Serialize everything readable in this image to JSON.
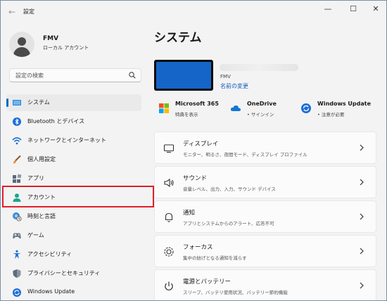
{
  "window": {
    "title": "設定",
    "back_glyph": "←",
    "minimize_glyph": "—",
    "maximize_glyph": "☐",
    "close_glyph": "✕"
  },
  "user": {
    "name": "FMV",
    "account_type": "ローカル アカウント"
  },
  "search": {
    "placeholder": "設定の検索"
  },
  "sidebar": {
    "items": [
      {
        "label": "システム",
        "icon": "display-icon",
        "selected": true
      },
      {
        "label": "Bluetooth とデバイス",
        "icon": "bluetooth-icon"
      },
      {
        "label": "ネットワークとインターネット",
        "icon": "wifi-icon"
      },
      {
        "label": "個人用設定",
        "icon": "brush-icon"
      },
      {
        "label": "アプリ",
        "icon": "apps-icon"
      },
      {
        "label": "アカウント",
        "icon": "account-icon",
        "highlighted": true
      },
      {
        "label": "時刻と言語",
        "icon": "globe-clock-icon"
      },
      {
        "label": "ゲーム",
        "icon": "gamepad-icon"
      },
      {
        "label": "アクセシビリティ",
        "icon": "accessibility-icon"
      },
      {
        "label": "プライバシーとセキュリティ",
        "icon": "shield-icon"
      },
      {
        "label": "Windows Update",
        "icon": "update-icon"
      }
    ]
  },
  "main": {
    "title": "システム",
    "device": {
      "model": "FMV",
      "rename_link": "名前の変更"
    },
    "services": [
      {
        "title": "Microsoft 365",
        "subtitle": "特典を表示",
        "icon": "microsoft-logo-icon"
      },
      {
        "title": "OneDrive",
        "subtitle": "• サインイン",
        "icon": "onedrive-cloud-icon"
      },
      {
        "title": "Windows Update",
        "subtitle": "• 注意が必要",
        "icon": "update-icon"
      }
    ],
    "cards": [
      {
        "title": "ディスプレイ",
        "subtitle": "モニター、明るさ、夜間モード、ディスプレイ プロファイル",
        "icon": "monitor-icon"
      },
      {
        "title": "サウンド",
        "subtitle": "音量レベル、出力、入力、サウンド デバイス",
        "icon": "speaker-icon"
      },
      {
        "title": "通知",
        "subtitle": "アプリとシステムからのアラート、応答不可",
        "icon": "bell-icon"
      },
      {
        "title": "フォーカス",
        "subtitle": "集中の妨げとなる通知を減らす",
        "icon": "focus-icon"
      },
      {
        "title": "電源とバッテリー",
        "subtitle": "スリープ、バッテリ使用状況、バッテリー節約機能",
        "icon": "power-icon"
      }
    ]
  },
  "colors": {
    "accent": "#0067c0",
    "link": "#0a5cbd",
    "highlight_box": "#e0202a"
  }
}
